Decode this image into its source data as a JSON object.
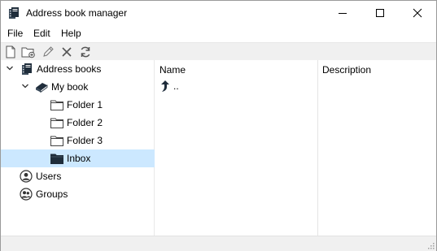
{
  "window": {
    "title": "Address book manager"
  },
  "menu": [
    "File",
    "Edit",
    "Help"
  ],
  "toolbar": {
    "buttons": [
      {
        "name": "new-file-icon"
      },
      {
        "name": "new-folder-icon"
      },
      {
        "name": "edit-pencil-icon"
      },
      {
        "name": "delete-x-icon"
      },
      {
        "name": "refresh-icon"
      }
    ]
  },
  "tree": {
    "root": {
      "label": "Address books",
      "icon": "address-books-icon",
      "expanded": true
    },
    "book": {
      "label": "My book",
      "icon": "book-icon",
      "expanded": true
    },
    "folders": [
      {
        "label": "Folder 1",
        "icon": "folder-icon"
      },
      {
        "label": "Folder 2",
        "icon": "folder-icon"
      },
      {
        "label": "Folder 3",
        "icon": "folder-icon"
      },
      {
        "label": "Inbox",
        "icon": "folder-filled-icon",
        "selected": true
      }
    ],
    "users": {
      "label": "Users",
      "icon": "user-icon"
    },
    "groups": {
      "label": "Groups",
      "icon": "group-icon"
    }
  },
  "list": {
    "columns": [
      "Name",
      "Description"
    ],
    "rows": [
      {
        "name": "..",
        "icon": "up-arrow-icon"
      }
    ]
  },
  "colors": {
    "selection": "#cce8ff",
    "toolbar_bg": "#f0f0f0",
    "status_bg": "#f0f0f0"
  }
}
